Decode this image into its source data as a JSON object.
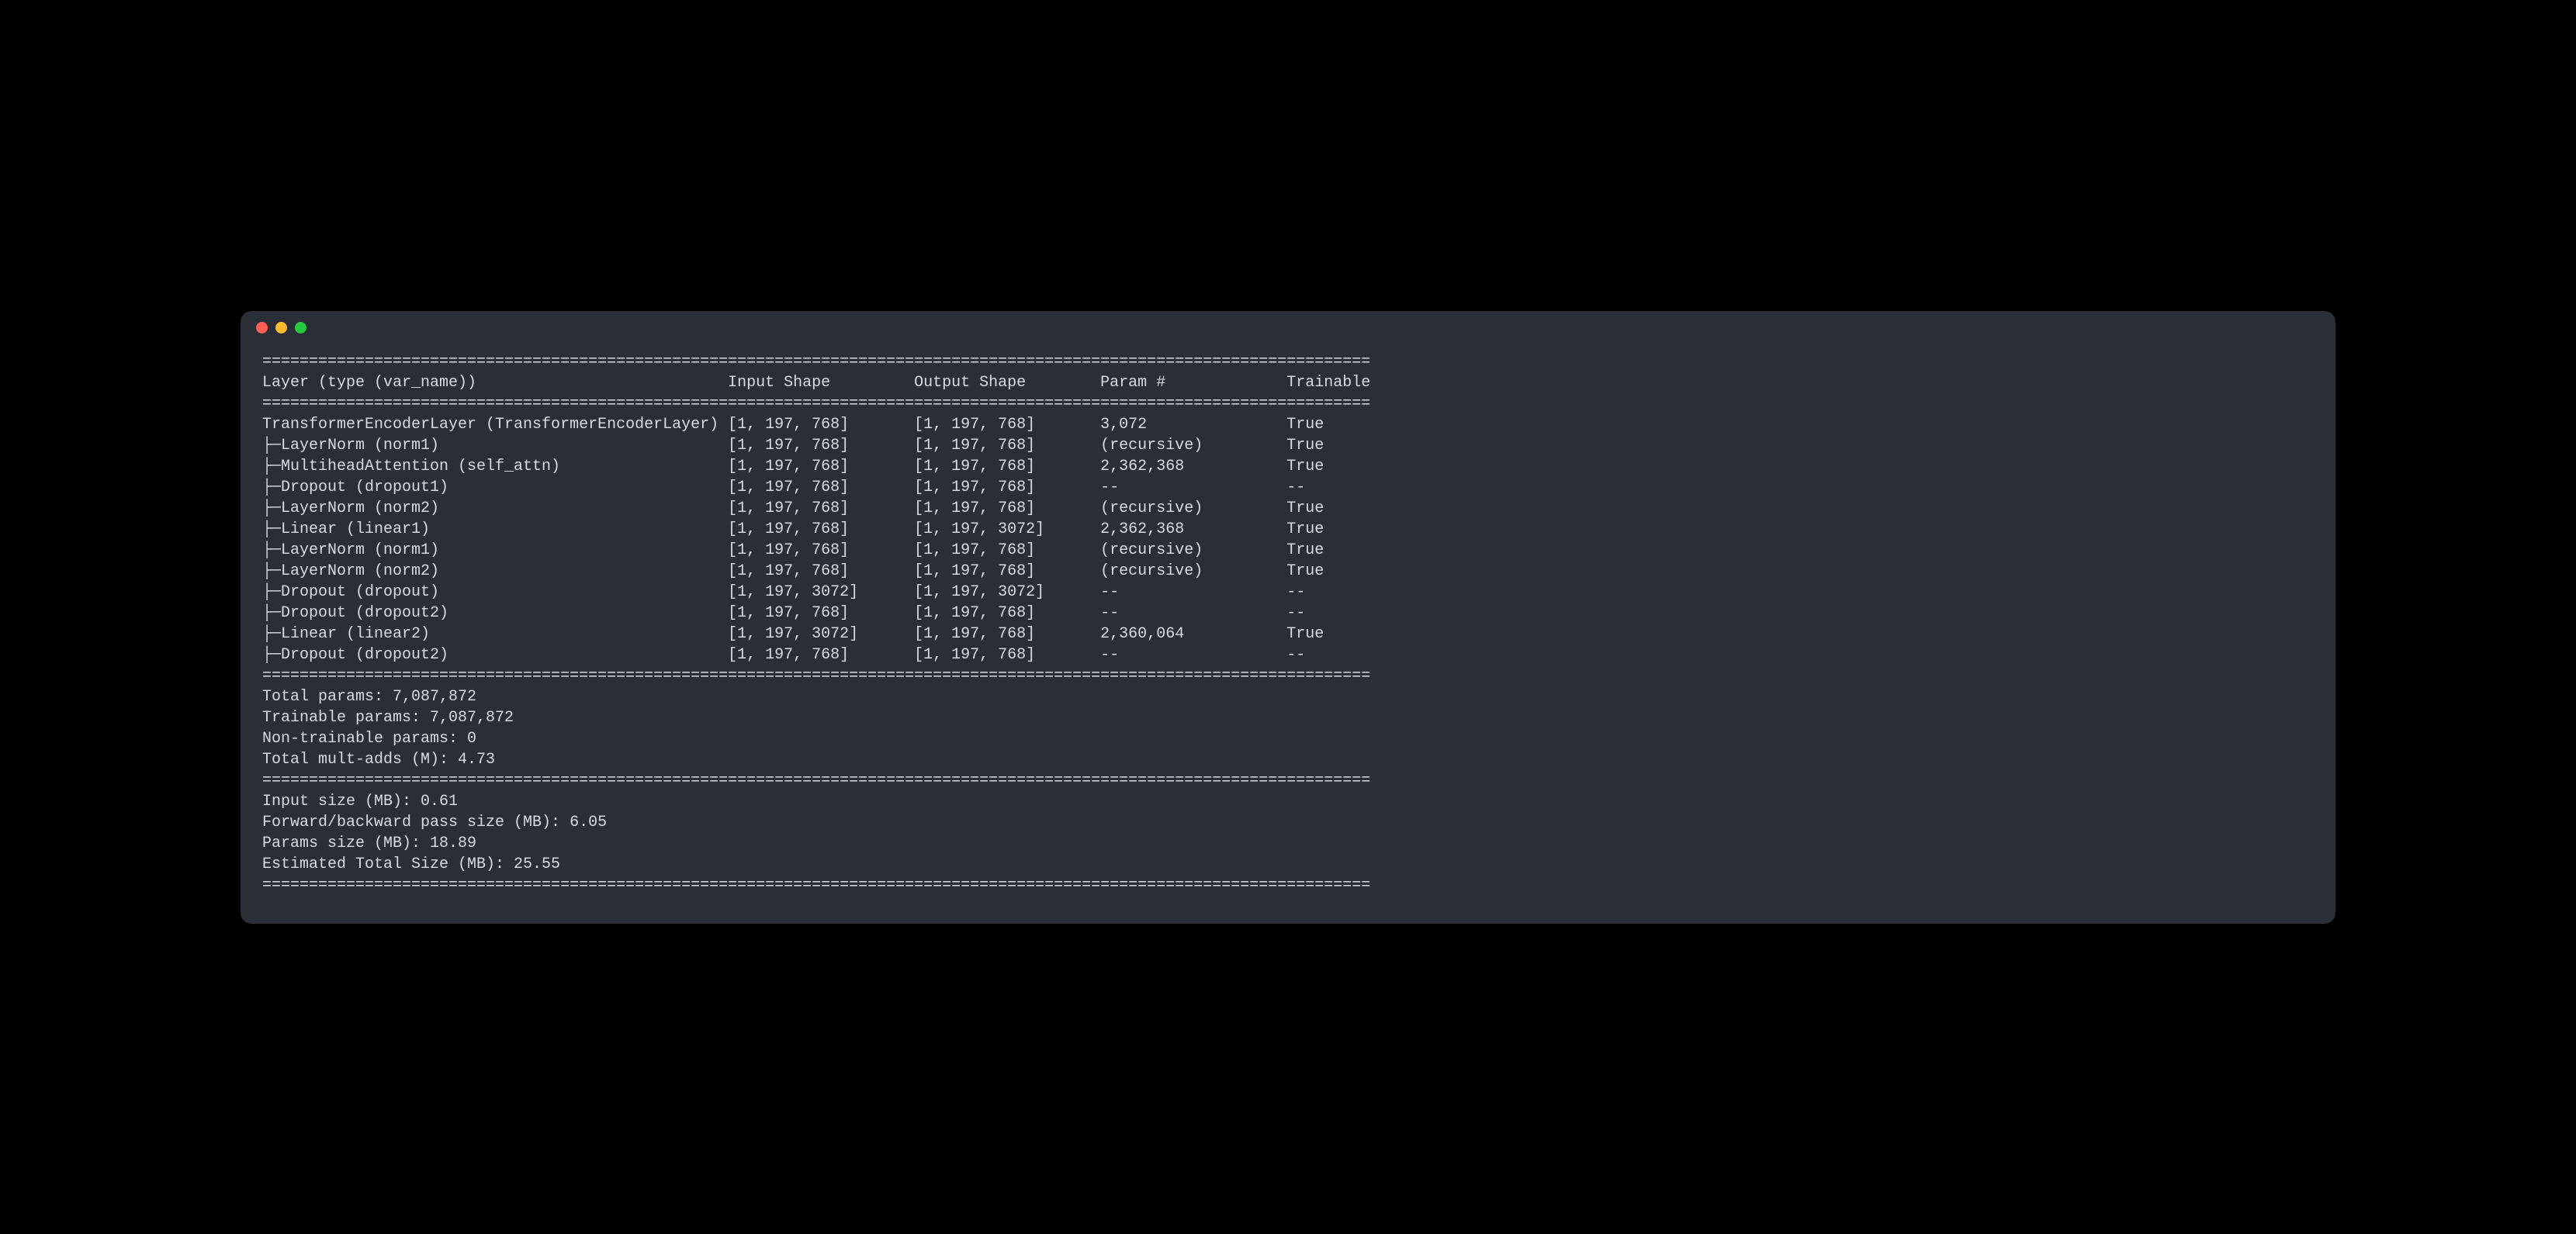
{
  "window": {
    "traffic_lights": [
      "close",
      "minimize",
      "maximize"
    ]
  },
  "header": {
    "col_layer": "Layer (type (var_name))",
    "col_input": "Input Shape",
    "col_output": "Output Shape",
    "col_param": "Param #",
    "col_trainable": "Trainable"
  },
  "branch": "├─",
  "rows": [
    {
      "layer": "TransformerEncoderLayer (TransformerEncoderLayer)",
      "input": "[1, 197, 768]",
      "output": "[1, 197, 768]",
      "param": "3,072",
      "trainable": "True",
      "child": false
    },
    {
      "layer": "LayerNorm (norm1)",
      "input": "[1, 197, 768]",
      "output": "[1, 197, 768]",
      "param": "(recursive)",
      "trainable": "True",
      "child": true
    },
    {
      "layer": "MultiheadAttention (self_attn)",
      "input": "[1, 197, 768]",
      "output": "[1, 197, 768]",
      "param": "2,362,368",
      "trainable": "True",
      "child": true
    },
    {
      "layer": "Dropout (dropout1)",
      "input": "[1, 197, 768]",
      "output": "[1, 197, 768]",
      "param": "--",
      "trainable": "--",
      "child": true
    },
    {
      "layer": "LayerNorm (norm2)",
      "input": "[1, 197, 768]",
      "output": "[1, 197, 768]",
      "param": "(recursive)",
      "trainable": "True",
      "child": true
    },
    {
      "layer": "Linear (linear1)",
      "input": "[1, 197, 768]",
      "output": "[1, 197, 3072]",
      "param": "2,362,368",
      "trainable": "True",
      "child": true
    },
    {
      "layer": "LayerNorm (norm1)",
      "input": "[1, 197, 768]",
      "output": "[1, 197, 768]",
      "param": "(recursive)",
      "trainable": "True",
      "child": true
    },
    {
      "layer": "LayerNorm (norm2)",
      "input": "[1, 197, 768]",
      "output": "[1, 197, 768]",
      "param": "(recursive)",
      "trainable": "True",
      "child": true
    },
    {
      "layer": "Dropout (dropout)",
      "input": "[1, 197, 3072]",
      "output": "[1, 197, 3072]",
      "param": "--",
      "trainable": "--",
      "child": true
    },
    {
      "layer": "Dropout (dropout2)",
      "input": "[1, 197, 768]",
      "output": "[1, 197, 768]",
      "param": "--",
      "trainable": "--",
      "child": true
    },
    {
      "layer": "Linear (linear2)",
      "input": "[1, 197, 3072]",
      "output": "[1, 197, 768]",
      "param": "2,360,064",
      "trainable": "True",
      "child": true
    },
    {
      "layer": "Dropout (dropout2)",
      "input": "[1, 197, 768]",
      "output": "[1, 197, 768]",
      "param": "--",
      "trainable": "--",
      "child": true
    }
  ],
  "summary1": [
    "Total params: 7,087,872",
    "Trainable params: 7,087,872",
    "Non-trainable params: 0",
    "Total mult-adds (M): 4.73"
  ],
  "summary2": [
    "Input size (MB): 0.61",
    "Forward/backward pass size (MB): 6.05",
    "Params size (MB): 18.89",
    "Estimated Total Size (MB): 25.55"
  ],
  "cols": {
    "layer_w": 50,
    "input_w": 20,
    "output_w": 20,
    "param_w": 20,
    "total_w": 119
  }
}
